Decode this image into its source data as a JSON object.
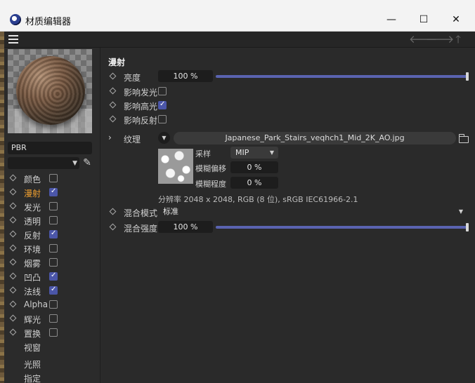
{
  "window": {
    "title": "材质编辑器",
    "minimize": "—",
    "maximize": "☐",
    "close": "✕"
  },
  "nav": {
    "back": "🡐",
    "forward": "🡒",
    "up": "🡑"
  },
  "left": {
    "material_name": "PBR",
    "channels": [
      {
        "label": "颜色",
        "checked": false,
        "active": false
      },
      {
        "label": "漫射",
        "checked": true,
        "active": true
      },
      {
        "label": "发光",
        "checked": false,
        "active": false
      },
      {
        "label": "透明",
        "checked": false,
        "active": false
      },
      {
        "label": "反射",
        "checked": true,
        "active": false
      },
      {
        "label": "环境",
        "checked": false,
        "active": false
      },
      {
        "label": "烟雾",
        "checked": false,
        "active": false
      },
      {
        "label": "凹凸",
        "checked": true,
        "active": false
      },
      {
        "label": "法线",
        "checked": true,
        "active": false
      },
      {
        "label": "Alpha",
        "checked": false,
        "active": false
      },
      {
        "label": "辉光",
        "checked": false,
        "active": false
      },
      {
        "label": "置换",
        "checked": false,
        "active": false
      }
    ],
    "extras": [
      "视窗",
      "光照",
      "指定"
    ]
  },
  "main": {
    "section_title": "漫射",
    "brightness": {
      "label": "亮度",
      "value": "100 %"
    },
    "affect_luminance": {
      "label": "影响发光",
      "checked": false
    },
    "affect_specular": {
      "label": "影响高光",
      "checked": true
    },
    "affect_reflection": {
      "label": "影响反射",
      "checked": false
    },
    "texture": {
      "label": "纹理",
      "filename": "Japanese_Park_Stairs_veqhch1_Mid_2K_AO.jpg",
      "sampling_label": "采样",
      "sampling_value": "MIP",
      "blur_offset_label": "模糊偏移",
      "blur_offset_value": "0 %",
      "blur_scale_label": "模糊程度",
      "blur_scale_value": "0 %",
      "resolution": "分辨率 2048 x 2048, RGB (8 位), sRGB IEC61966-2.1"
    },
    "mix_mode": {
      "label": "混合模式",
      "value": "标准"
    },
    "mix_strength": {
      "label": "混合强度",
      "value": "100 %"
    }
  },
  "colors": {
    "accent": "#5a63b0",
    "active_channel": "#f0a030",
    "checkbox_on": "#4b56a8"
  }
}
